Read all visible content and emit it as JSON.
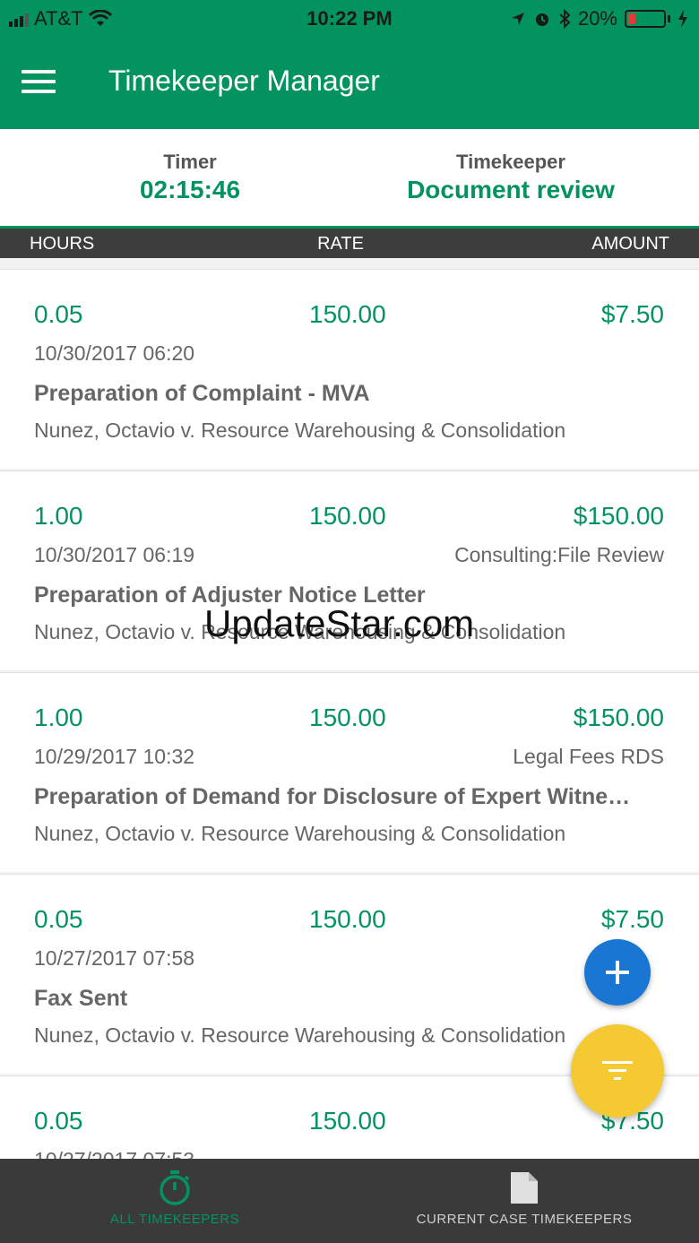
{
  "status_bar": {
    "carrier": "AT&T",
    "time": "10:22 PM",
    "battery_percent": "20%",
    "battery_level": 0.2,
    "icons": [
      "signal-icon",
      "wifi-icon",
      "location-icon",
      "alarm-icon",
      "bluetooth-icon",
      "battery-icon",
      "charging-icon"
    ]
  },
  "app_bar": {
    "title": "Timekeeper Manager"
  },
  "timer_panel": {
    "timer_label": "Timer",
    "timer_value": "02:15:46",
    "timekeeper_label": "Timekeeper",
    "timekeeper_value": "Document review"
  },
  "columns": {
    "hours": "HOURS",
    "rate": "RATE",
    "amount": "AMOUNT"
  },
  "entries": [
    {
      "hours": "0.05",
      "rate": "150.00",
      "amount": "$7.50",
      "date": "10/30/2017 06:20",
      "category": "",
      "description": "Preparation of Complaint - MVA",
      "case": "Nunez, Octavio v. Resource Warehousing & Consolidation"
    },
    {
      "hours": "1.00",
      "rate": "150.00",
      "amount": "$150.00",
      "date": "10/30/2017 06:19",
      "category": "Consulting:File Review",
      "description": "Preparation of Adjuster Notice Letter",
      "case": "Nunez, Octavio v. Resource Warehousing & Consolidation"
    },
    {
      "hours": "1.00",
      "rate": "150.00",
      "amount": "$150.00",
      "date": "10/29/2017 10:32",
      "category": "Legal Fees RDS",
      "description": "Preparation of Demand for Disclosure of Expert Witne…",
      "case": "Nunez, Octavio v. Resource Warehousing & Consolidation"
    },
    {
      "hours": "0.05",
      "rate": "150.00",
      "amount": "$7.50",
      "date": "10/27/2017 07:58",
      "category": "",
      "description": "Fax Sent",
      "case": "Nunez, Octavio v. Resource Warehousing & Consolidation"
    },
    {
      "hours": "0.05",
      "rate": "150.00",
      "amount": "$7.50",
      "date": "10/27/2017 07:53",
      "category": "",
      "description": "",
      "case": ""
    }
  ],
  "watermark": "UpdateStar.com",
  "fabs": {
    "add_icon": "plus-icon",
    "filter_icon": "filter-icon"
  },
  "bottom_nav": {
    "all_label": "ALL TIMEKEEPERS",
    "all_icon": "stopwatch-icon",
    "current_label": "CURRENT CASE TIMEKEEPERS",
    "current_icon": "document-icon"
  },
  "colors": {
    "primary": "#03935f",
    "fab_add": "#1976d2",
    "fab_filter": "#f5c932",
    "nav_background": "#3a3a3a"
  }
}
